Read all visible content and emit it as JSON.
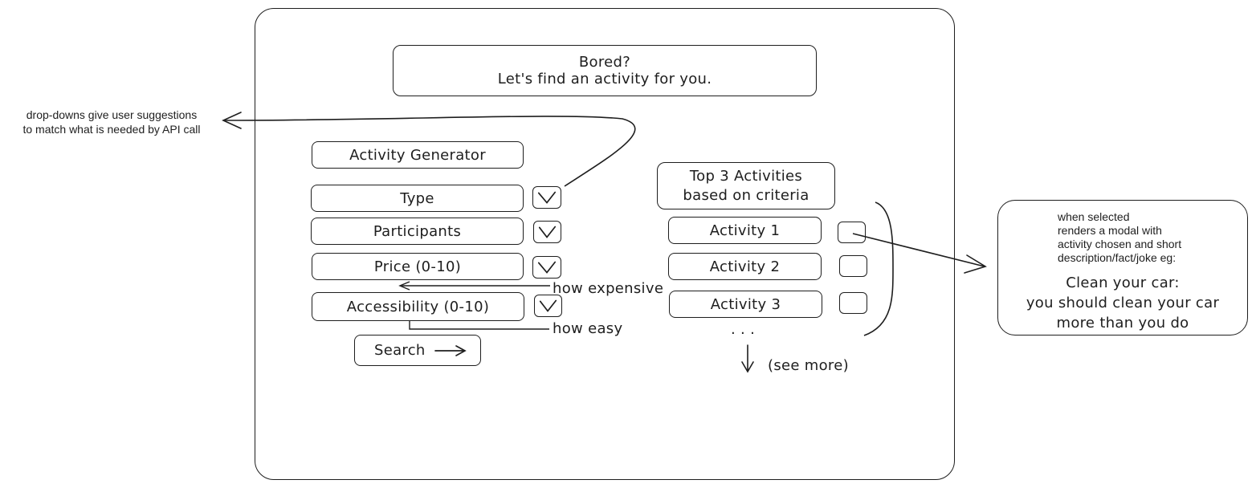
{
  "header": {
    "line1": "Bored?",
    "line2": "Let's find an activity for you."
  },
  "generator": {
    "title": "Activity Generator",
    "fields": [
      {
        "label": "Type"
      },
      {
        "label": "Participants"
      },
      {
        "label": "Price (0-10)",
        "note": "how expensive"
      },
      {
        "label": "Accessibility (0-10)",
        "note": "how easy"
      }
    ],
    "search_label": "Search",
    "dropdown_note": [
      "drop-downs give user suggestions",
      "to match what is needed by API call"
    ]
  },
  "results": {
    "title_line1": "Top 3 Activities",
    "title_line2": "based on criteria",
    "items": [
      "Activity 1",
      "Activity 2",
      "Activity 3"
    ],
    "ellipsis": ". . .",
    "see_more": "(see more)"
  },
  "modal_note": {
    "lines": [
      "when selected",
      "renders a modal with",
      "activity chosen and short",
      "description/fact/joke eg:"
    ],
    "example": [
      "Clean your car:",
      "you should clean your car",
      "more than you do"
    ]
  },
  "icons": {
    "dropdown": "chevron-down-icon",
    "search_arrow": "arrow-right-icon",
    "checkbox": "checkbox-icon",
    "scroll_arrow": "arrow-down-icon"
  }
}
